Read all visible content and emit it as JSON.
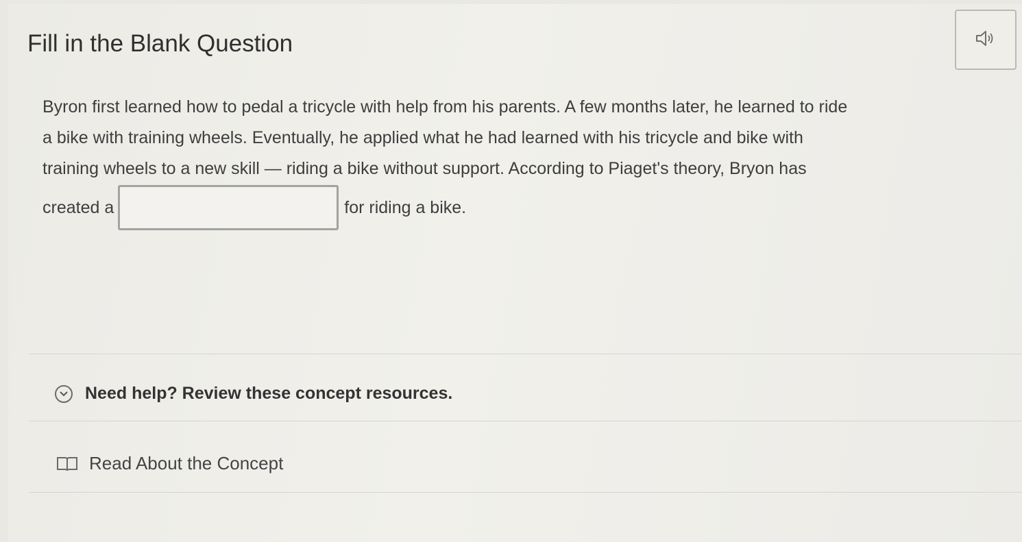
{
  "question": {
    "heading": "Fill in the Blank Question",
    "audio_icon": "speaker-icon",
    "lines": [
      "Byron first learned how to pedal a tricycle with help from his parents. A few months later, he learned to ride",
      "a bike with training wheels. Eventually, he applied what he had learned with his tricycle and bike with",
      "training wheels to a new skill — riding a bike without support. According to Piaget's theory, Bryon has"
    ],
    "before_blank": "created a",
    "blank_value": "",
    "after_blank": "for riding a bike."
  },
  "help": {
    "icon": "chevron-down-circle-icon",
    "label": "Need help? Review these concept resources."
  },
  "resources": [
    {
      "icon": "book-icon",
      "label": "Read About the Concept"
    }
  ]
}
